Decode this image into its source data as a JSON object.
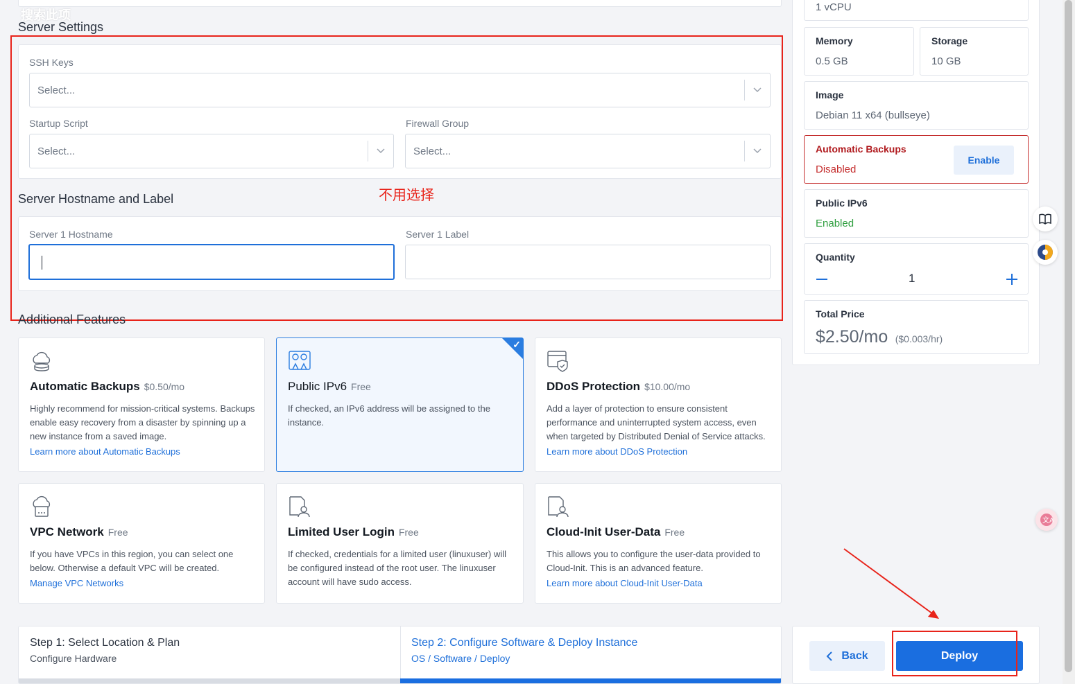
{
  "watermark": "搜索此项",
  "server_settings": {
    "title": "Server Settings",
    "ssh_keys": {
      "label": "SSH Keys",
      "placeholder": "Select..."
    },
    "startup_script": {
      "label": "Startup Script",
      "placeholder": "Select..."
    },
    "firewall_group": {
      "label": "Firewall Group",
      "placeholder": "Select..."
    }
  },
  "hostname_section": {
    "title": "Server Hostname and Label",
    "hostname": {
      "label": "Server 1 Hostname",
      "value": ""
    },
    "label": {
      "label": "Server 1 Label",
      "value": ""
    }
  },
  "annotation": "不用选择",
  "additional_features": {
    "title": "Additional Features",
    "items": [
      {
        "name": "Automatic Backups",
        "price": "$0.50/mo",
        "desc": "Highly recommend for mission-critical systems. Backups enable easy recovery from a disaster by spinning up a new instance from a saved image.",
        "link": "Learn more about Automatic Backups",
        "selected": false,
        "icon": "cloud-backup-icon"
      },
      {
        "name": "Public IPv6",
        "price": "Free",
        "desc": "If checked, an IPv6 address will be assigned to the instance.",
        "link": "",
        "selected": true,
        "icon": "ip-pin-icon"
      },
      {
        "name": "DDoS Protection",
        "price": "$10.00/mo",
        "desc": "Add a layer of protection to ensure consistent performance and uninterrupted system access, even when targeted by Distributed Denial of Service attacks.",
        "link": "Learn more about DDoS Protection",
        "selected": false,
        "icon": "shield-window-icon"
      },
      {
        "name": "VPC Network",
        "price": "Free",
        "desc": "If you have VPCs in this region, you can select one below. Otherwise a default VPC will be created.",
        "link": "Manage VPC Networks",
        "selected": false,
        "icon": "cloud-network-icon"
      },
      {
        "name": "Limited User Login",
        "price": "Free",
        "desc": "If checked, credentials for a limited user (linuxuser) will be configured instead of the root user. The linuxuser account will have sudo access.",
        "link": "",
        "selected": false,
        "icon": "user-document-icon"
      },
      {
        "name": "Cloud-Init User-Data",
        "price": "Free",
        "desc": "This allows you to configure the user-data provided to Cloud-Init. This is an advanced feature.",
        "link": "Learn more about Cloud-Init User-Data",
        "selected": false,
        "icon": "user-document-icon"
      }
    ]
  },
  "summary": {
    "cpu": "1 vCPU",
    "memory": {
      "label": "Memory",
      "value": "0.5 GB"
    },
    "storage": {
      "label": "Storage",
      "value": "10 GB"
    },
    "image": {
      "label": "Image",
      "value": "Debian 11 x64 (bullseye)"
    },
    "backups": {
      "label": "Automatic Backups",
      "value": "Disabled",
      "button": "Enable"
    },
    "ipv6": {
      "label": "Public IPv6",
      "value": "Enabled"
    },
    "quantity": {
      "label": "Quantity",
      "value": "1"
    },
    "total": {
      "label": "Total Price",
      "value": "$2.50/mo",
      "hourly": "($0.003/hr)"
    }
  },
  "steps": {
    "step1": {
      "title": "Step 1: Select Location & Plan",
      "sub": "Configure Hardware"
    },
    "step2": {
      "title": "Step 2: Configure Software & Deploy Instance",
      "sub": "OS / Software / Deploy"
    }
  },
  "actions": {
    "back": "Back",
    "deploy": "Deploy"
  },
  "colors": {
    "accent": "#1a6ee0",
    "annotation_red": "#e8231a",
    "warning_red": "#c42b2b",
    "success_green": "#2e9e3e"
  }
}
